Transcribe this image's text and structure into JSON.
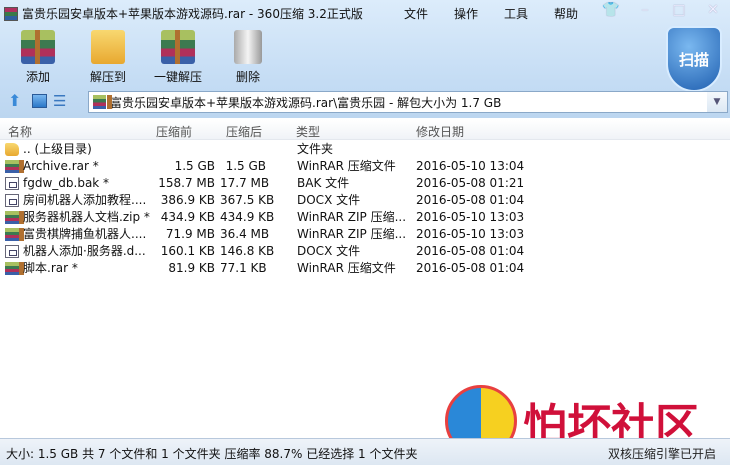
{
  "window": {
    "title": "富贵乐园安卓版本+苹果版本游戏源码.rar - 360压缩 3.2正式版"
  },
  "menu": [
    "文件",
    "操作",
    "工具",
    "帮助"
  ],
  "toolbar": {
    "add": "添加",
    "extract_to": "解压到",
    "one_click": "一键解压",
    "delete": "删除",
    "scan": "扫描"
  },
  "address": {
    "path": "富贵乐园安卓版本+苹果版本游戏源码.rar\\富贵乐园 - 解包大小为 1.7 GB"
  },
  "columns": [
    "名称",
    "压缩前",
    "压缩后",
    "类型",
    "修改日期"
  ],
  "files": [
    {
      "name": ".. (上级目录)",
      "before": "",
      "after": "",
      "type": "文件夹",
      "date": "",
      "icon": "folder"
    },
    {
      "name": "Archive.rar *",
      "before": "1.5 GB",
      "after": "1.5 GB",
      "type": "WinRAR 压缩文件",
      "date": "2016-05-10 13:04",
      "icon": "rar"
    },
    {
      "name": "fgdw_db.bak *",
      "before": "158.7 MB",
      "after": "17.7 MB",
      "type": "BAK 文件",
      "date": "2016-05-08 01:21",
      "icon": "doc"
    },
    {
      "name": "房间机器人添加教程....",
      "before": "386.9 KB",
      "after": "367.5 KB",
      "type": "DOCX 文件",
      "date": "2016-05-08 01:04",
      "icon": "doc"
    },
    {
      "name": "服务器机器人文档.zip *",
      "before": "434.9 KB",
      "after": "434.9 KB",
      "type": "WinRAR ZIP 压缩...",
      "date": "2016-05-10 13:03",
      "icon": "rar"
    },
    {
      "name": "富贵棋牌捕鱼机器人....",
      "before": "71.9 MB",
      "after": "36.4 MB",
      "type": "WinRAR ZIP 压缩...",
      "date": "2016-05-10 13:03",
      "icon": "rar"
    },
    {
      "name": "机器人添加·服务器.d...",
      "before": "160.1 KB",
      "after": "146.8 KB",
      "type": "DOCX 文件",
      "date": "2016-05-08 01:04",
      "icon": "doc"
    },
    {
      "name": "脚本.rar *",
      "before": "81.9 KB",
      "after": "77.1 KB",
      "type": "WinRAR 压缩文件",
      "date": "2016-05-08 01:04",
      "icon": "rar"
    }
  ],
  "status": {
    "left": "大小: 1.5 GB 共 7 个文件和 1 个文件夹 压缩率 88.7% 已经选择 1 个文件夹",
    "right": "双核压缩引擎已开启"
  },
  "watermark": {
    "text": "怕坏社区"
  }
}
